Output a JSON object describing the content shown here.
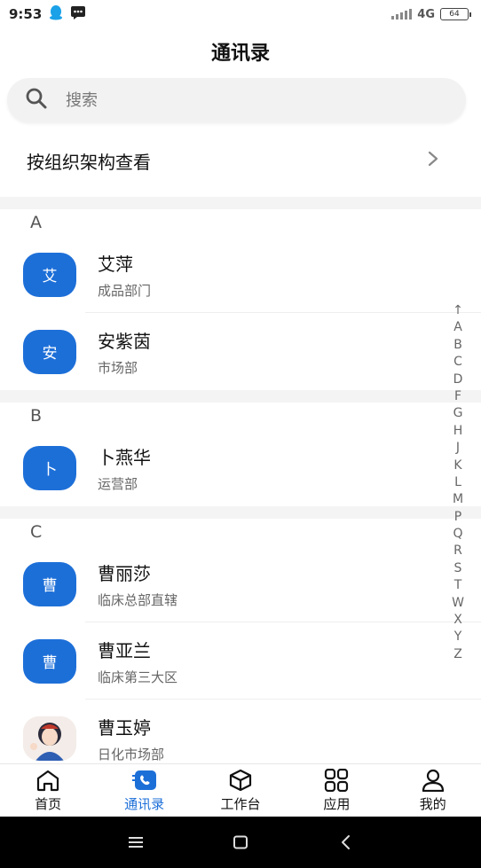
{
  "status_bar": {
    "time": "9:53",
    "network": "4G",
    "battery": "64"
  },
  "header": {
    "title": "通讯录"
  },
  "search": {
    "placeholder": "搜索",
    "icon": "search-icon"
  },
  "org_entry": {
    "label": "按组织架构查看",
    "icon": "chevron-right-icon"
  },
  "groups": [
    {
      "letter": "A",
      "contacts": [
        {
          "name": "艾萍",
          "dept": "成品部门",
          "avatar_text": "艾"
        },
        {
          "name": "安紫茵",
          "dept": "市场部",
          "avatar_text": "安"
        }
      ]
    },
    {
      "letter": "B",
      "contacts": [
        {
          "name": "卜燕华",
          "dept": "运营部",
          "avatar_text": "卜"
        }
      ]
    },
    {
      "letter": "C",
      "contacts": [
        {
          "name": "曹丽莎",
          "dept": "临床总部直辖",
          "avatar_text": "曹"
        },
        {
          "name": "曹亚兰",
          "dept": "临床第三大区",
          "avatar_text": "曹"
        },
        {
          "name": "曹玉婷",
          "dept": "日化市场部",
          "avatar_text": ""
        }
      ]
    }
  ],
  "alpha_index": [
    "↑",
    "A",
    "B",
    "C",
    "D",
    "F",
    "G",
    "H",
    "J",
    "K",
    "L",
    "M",
    "P",
    "Q",
    "R",
    "S",
    "T",
    "W",
    "X",
    "Y",
    "Z"
  ],
  "bottom_nav": [
    {
      "label": "首页",
      "icon": "home-icon",
      "active": false
    },
    {
      "label": "通讯录",
      "icon": "contacts-icon",
      "active": true
    },
    {
      "label": "工作台",
      "icon": "workbench-icon",
      "active": false
    },
    {
      "label": "应用",
      "icon": "apps-icon",
      "active": false
    },
    {
      "label": "我的",
      "icon": "profile-icon",
      "active": false
    }
  ],
  "colors": {
    "accent": "#1d6fd8",
    "avatar_bg": "#1d6fd8",
    "search_bg": "#f2f2f2",
    "system_bar": "#000000"
  }
}
